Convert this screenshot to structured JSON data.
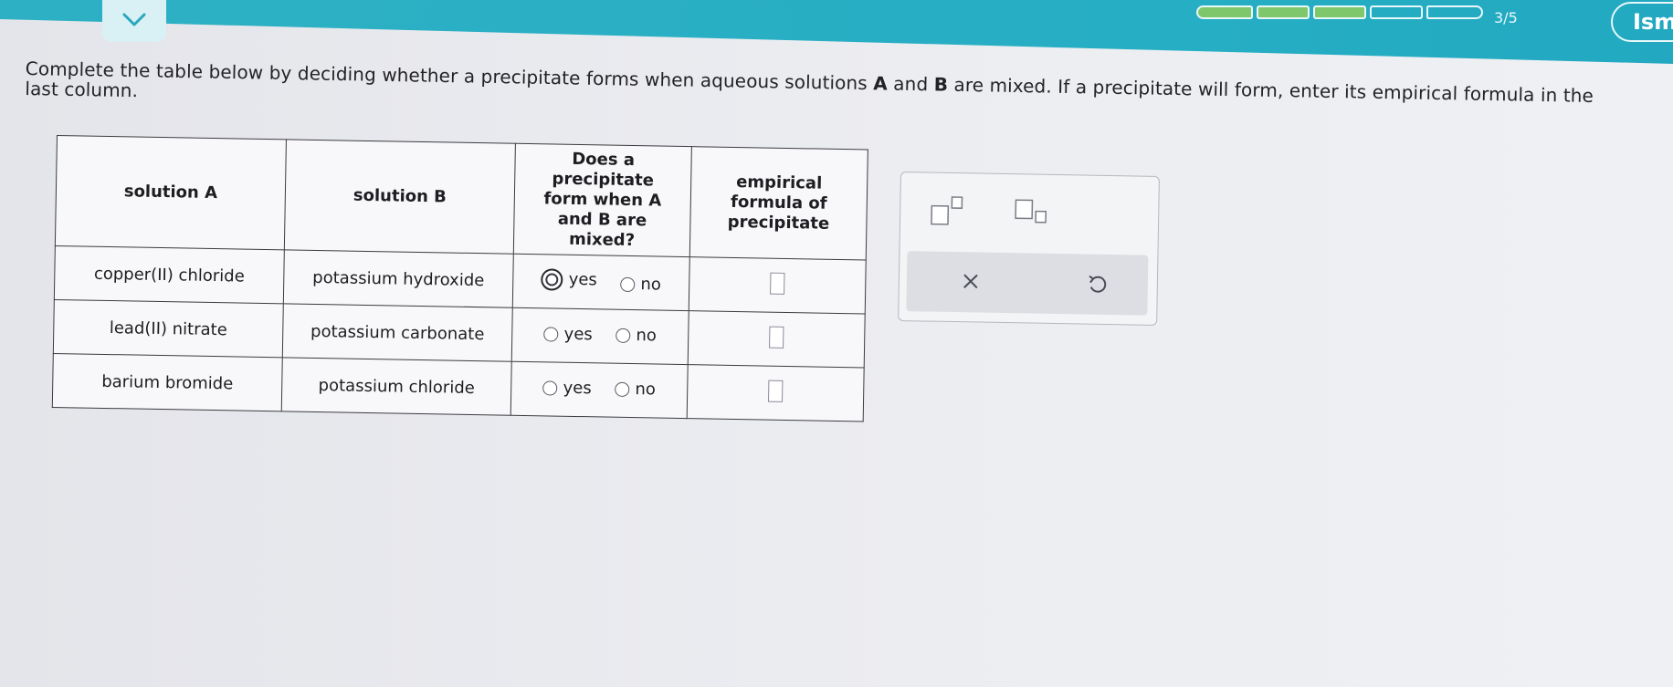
{
  "header": {
    "progress_text": "3/5",
    "progress_segments": [
      true,
      true,
      true,
      false,
      false
    ],
    "user_name": "Isma"
  },
  "instructions": {
    "part1": "Complete the table below by deciding whether a precipitate forms when aqueous solutions ",
    "bold_a": "A",
    "part2": " and ",
    "bold_b": "B",
    "part3": " are mixed. If a precipitate will form, enter its empirical formula in the last column."
  },
  "table": {
    "headers": {
      "solution_a": "solution A",
      "solution_b": "solution B",
      "precipitate_question": "Does a precipitate form when A and B are mixed?",
      "formula": "empirical formula of precipitate"
    },
    "rows": [
      {
        "solution_a": "copper(II) chloride",
        "solution_b": "potassium hydroxide",
        "yes_label": "yes",
        "no_label": "no",
        "selected": "yes"
      },
      {
        "solution_a": "lead(II) nitrate",
        "solution_b": "potassium carbonate",
        "yes_label": "yes",
        "no_label": "no",
        "selected": ""
      },
      {
        "solution_a": "barium bromide",
        "solution_b": "potassium chloride",
        "yes_label": "yes",
        "no_label": "no",
        "selected": ""
      }
    ]
  },
  "palette": {
    "tools": [
      "superscript-tool",
      "subscript-tool"
    ],
    "clear_symbol": "×",
    "undo_icon": "undo-icon"
  },
  "colors": {
    "header_bar": "#26aec4",
    "progress_filled": "#7ec86b"
  }
}
